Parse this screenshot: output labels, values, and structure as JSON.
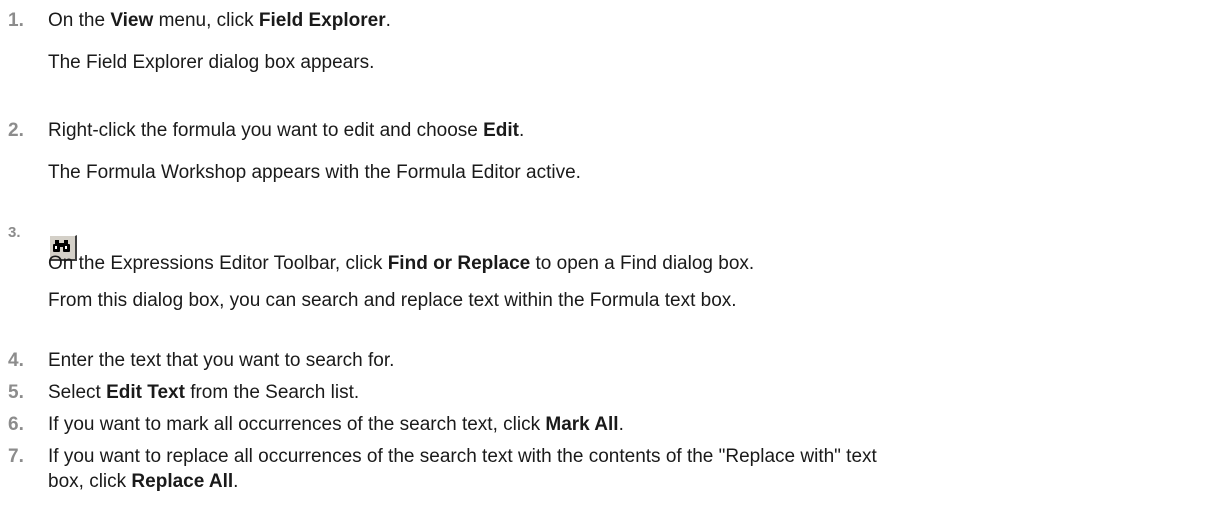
{
  "steps": [
    {
      "number": "1.",
      "pre": "On the ",
      "b1": "View",
      "mid": " menu, click ",
      "b2": "Field Explorer",
      "post": ".",
      "note": "The Field Explorer dialog box appears."
    },
    {
      "number": "2.",
      "pre": "Right-click the formula you want to edit and choose ",
      "b1": "Edit",
      "post": ".",
      "note": "The Formula Workshop appears with the Formula Editor active."
    },
    {
      "number": "3.",
      "icon": "binoculars-icon",
      "pre": "On the Expressions Editor Toolbar, click ",
      "b1": "Find or Replace",
      "post": " to open a Find dialog box.",
      "note": "From this dialog box, you can search and replace text within the Formula text box."
    },
    {
      "number": "4.",
      "text": "Enter the text that you want to search for."
    },
    {
      "number": "5.",
      "pre": "Select ",
      "b1": "Edit Text",
      "post": " from the Search list."
    },
    {
      "number": "6.",
      "pre": "If you want to mark all occurrences of the search text, click ",
      "b1": "Mark All",
      "post": "."
    },
    {
      "number": "7.",
      "line1": "If you want to replace all occurrences of the search text with the contents of the \"Replace with\" text",
      "pre": "box, click ",
      "b1": "Replace All",
      "post": "."
    }
  ]
}
